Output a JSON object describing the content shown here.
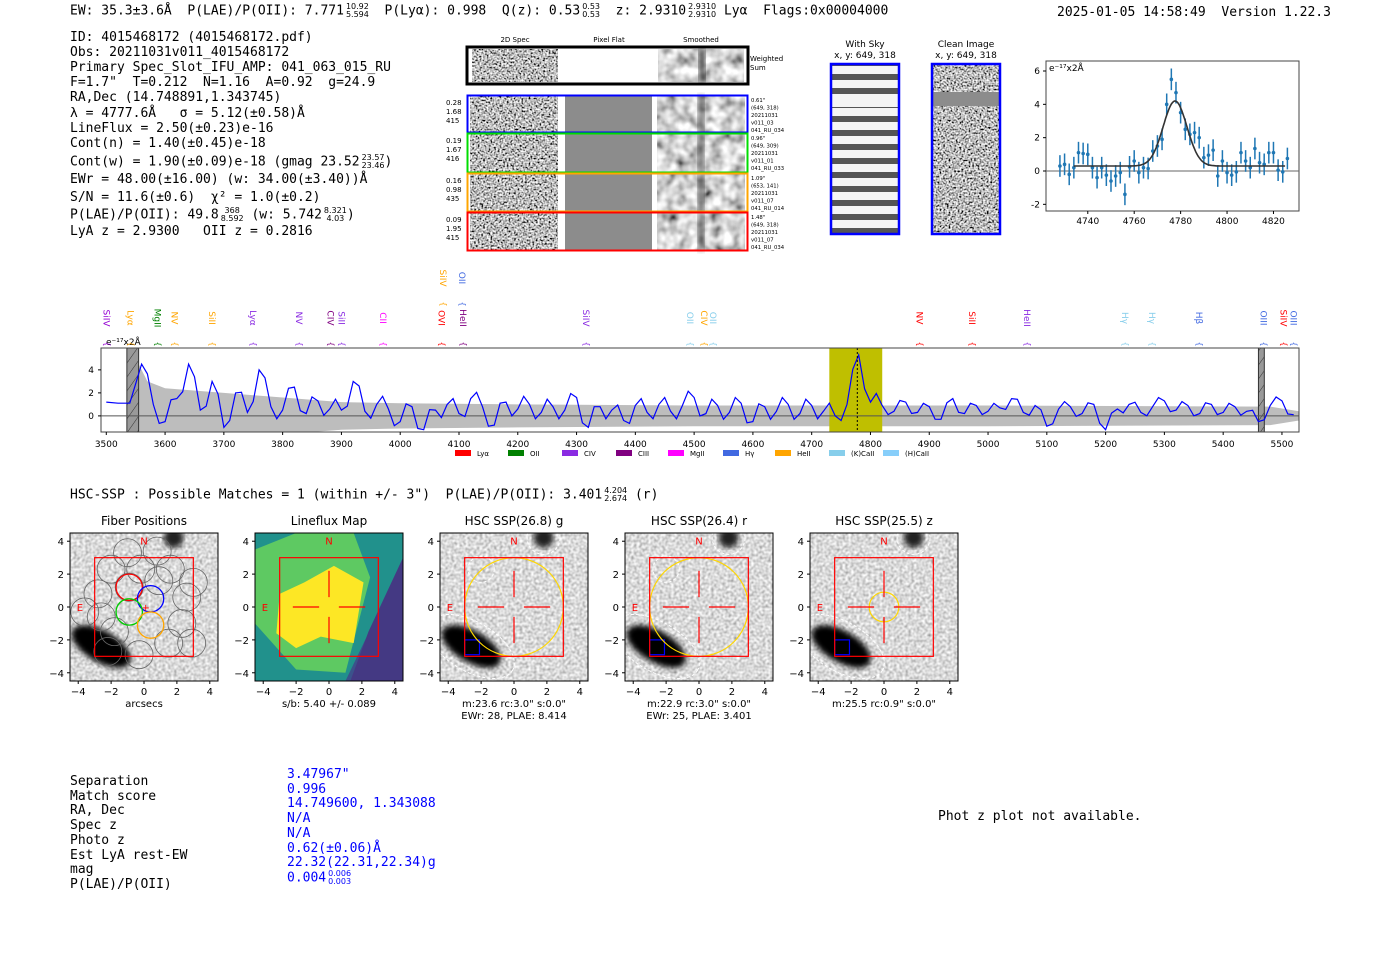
{
  "header": {
    "ew": "EW: 35.3±3.6Å",
    "plae": "P(LAE)/P(OII): 7.771",
    "plae_hi": "10.92",
    "plae_lo": "5.594",
    "plya": "P(Lyα): 0.998",
    "qz": "Q(z): 0.53",
    "qz_hi": "0.53",
    "qz_lo": "0.53",
    "z": "z: 2.9310",
    "z_hi": "2.9310",
    "z_lo": "2.9310",
    "z_line": "Lyα",
    "flags": "Flags:0x00004000",
    "datetime": "2025-01-05 14:58:49",
    "version": "Version 1.22.3"
  },
  "info": {
    "id": "ID: 4015468172 (4015468172.pdf)",
    "obs": "Obs: 20211031v011_4015468172",
    "primary": "Primary Spec_Slot_IFU_AMP: 041_063_015_RU",
    "params": "F=1.7\"  T=0.212  N=1.16  A=0.92  g=24.9",
    "radec": "RA,Dec (14.748891,1.343745)",
    "lambda": "λ = 4777.6Å   σ = 5.12(±0.58)Å",
    "lineflux": "LineFlux = 2.50(±0.23)e-16",
    "cont_n": "Cont(n) = 1.40(±0.45)e-18",
    "cont_w": "Cont(w) = 1.90(±0.09)e-18 (gmag 23.52",
    "cont_w_hi": "23.57",
    "cont_w_lo": "23.46",
    "cont_w_post": ")",
    "ewr": "EWr = 48.00(±16.00) (w: 34.00(±3.40))Å",
    "sn": "S/N = 11.6(±0.6)  χ² = 1.0(±0.2)",
    "plae": "P(LAE)/P(OII): 49.8",
    "plae_hi": "368",
    "plae_lo": "8.592",
    "plae_w": "(w: 5.742",
    "plae_w_hi": "8.321",
    "plae_w_lo": "4.03",
    "plae_post": ")",
    "z": "LyA z = 2.9300   OII z = 0.2816"
  },
  "spec2d": {
    "col_headers": [
      "2D Spec",
      "Pixel Flat",
      "Smoothed"
    ],
    "weighted_label": [
      "Weighted",
      "Sum"
    ],
    "rows": [
      {
        "color": "#0000ff",
        "vals": [
          "0.28",
          "1.68",
          "415"
        ],
        "meta": [
          "0.61\"",
          "(649, 318)",
          "20211031",
          "v011_03",
          "041_RU_034"
        ]
      },
      {
        "color": "#00dd00",
        "vals": [
          "0.19",
          "1.67",
          "416"
        ],
        "meta": [
          "0.96\"",
          "(649, 309)",
          "20211031",
          "v011_01",
          "041_RU_033"
        ]
      },
      {
        "color": "#ffa500",
        "vals": [
          "0.16",
          "0.98",
          "435"
        ],
        "meta": [
          "1.09\"",
          "(653, 141)",
          "20211031",
          "v011_07",
          "041_RU_014"
        ]
      },
      {
        "color": "#ff0000",
        "vals": [
          "0.09",
          "1.95",
          "415"
        ],
        "meta": [
          "1.48\"",
          "(649, 318)",
          "20211031",
          "v011_07",
          "041_RU_034"
        ]
      }
    ]
  },
  "cutouts": [
    {
      "title": "With Sky",
      "coords": "x, y: 649, 318"
    },
    {
      "title": "Clean Image",
      "coords": "x, y: 649, 318"
    }
  ],
  "chart_data": [
    {
      "type": "line",
      "title": "",
      "unit_label": "e⁻¹⁷x2Å",
      "xlim": [
        3491,
        5529
      ],
      "ylim": [
        -1.4,
        5.9
      ],
      "xticks": [
        3500,
        3600,
        3700,
        3800,
        3900,
        4000,
        4100,
        4200,
        4300,
        4400,
        4500,
        4600,
        4700,
        4800,
        4900,
        5000,
        5100,
        5200,
        5300,
        5400,
        5500
      ],
      "yticks": [
        0,
        2,
        4
      ],
      "x_start": 3500,
      "x_step": 20,
      "flux": [
        1.2,
        1.1,
        1.1,
        4.5,
        1.0,
        -0.5,
        1.5,
        4.5,
        0.5,
        3.0,
        -1.0,
        2.0,
        0.3,
        4.0,
        0.8,
        0.5,
        2.5,
        0.2,
        1.3,
        0.6,
        0.5,
        3.0,
        0.4,
        1.0,
        0.6,
        -0.5,
        0.8,
        -1.2,
        0.5,
        1.0,
        0.2,
        1.5,
        0.8,
        -0.8,
        1.2,
        0.6,
        1.0,
        0.3,
        0.8,
        0.5,
        1.6,
        -1.0,
        0.8,
        0.5,
        -0.4,
        0.9,
        0.3,
        1.0,
        0.4,
        0.9,
        1.6,
        0.2,
        0.9,
        0.3,
        1.1,
        -0.5,
        0.8,
        0.4,
        1.0,
        0.2,
        0.9,
        0.4,
        0.0,
        1.0,
        5.3,
        1.2,
        0.9,
        0.4,
        1.2,
        0.3,
        0.8,
        -0.3,
        1.5,
        0.2,
        0.9,
        0.4,
        0.7,
        1.5,
        0.3,
        0.9,
        -0.9,
        0.6,
        0.8,
        0.2,
        1.0,
        -1.2,
        0.6,
        1.0,
        0.3,
        0.8,
        1.3,
        0.5,
        0.9,
        0.2,
        1.0,
        0.3,
        0.8,
        0.4,
        -0.5,
        0.9,
        1.3,
        0.1
      ],
      "error_envelope": [
        [
          3555,
          4.5
        ],
        [
          3570,
          3.0
        ],
        [
          3600,
          2.4
        ],
        [
          3700,
          2.0
        ],
        [
          3800,
          1.6
        ],
        [
          3900,
          1.2
        ],
        [
          4000,
          1.1
        ],
        [
          4200,
          1.0
        ],
        [
          4500,
          0.9
        ],
        [
          5000,
          0.9
        ],
        [
          5480,
          0.8
        ],
        [
          5529,
          0.4
        ]
      ],
      "highlight_band": [
        4730,
        4820
      ],
      "line_center": 4777.6,
      "masked_bands": [
        [
          3535,
          3555
        ],
        [
          5460,
          5470
        ]
      ],
      "line_labels": [
        {
          "label": "SiIV",
          "wave": 3500,
          "color": "#9400d3",
          "row": 0
        },
        {
          "label": "Lyα",
          "wave": 3541,
          "color": "#ffa500",
          "row": 0
        },
        {
          "label": "MgII",
          "wave": 3587,
          "color": "#008000",
          "row": 0
        },
        {
          "label": "NV",
          "wave": 3616,
          "color": "#ffa500",
          "row": 0
        },
        {
          "label": "SiII",
          "wave": 3680,
          "color": "#ffa500",
          "row": 0
        },
        {
          "label": "Lyα",
          "wave": 3750,
          "color": "#8a2be2",
          "row": 0
        },
        {
          "label": "NV",
          "wave": 3828,
          "color": "#8a2be2",
          "row": 0
        },
        {
          "label": "CIV",
          "wave": 3881,
          "color": "#800080",
          "row": 0
        },
        {
          "label": "SiII",
          "wave": 3900,
          "color": "#8a2be2",
          "row": 0
        },
        {
          "label": "CII",
          "wave": 3971,
          "color": "#ff00ff",
          "row": 0
        },
        {
          "label": "OVI",
          "wave": 4070,
          "color": "#ff0000",
          "row": 0
        },
        {
          "label": "HeII",
          "wave": 4107,
          "color": "#800080",
          "row": 0
        },
        {
          "label": "SiIV",
          "wave": 4073,
          "color": "#ffa500",
          "row": 1
        },
        {
          "label": "OII",
          "wave": 4105,
          "color": "#4169e1",
          "row": 1
        },
        {
          "label": "SiIV",
          "wave": 4316,
          "color": "#8a2be2",
          "row": 0
        },
        {
          "label": "OII",
          "wave": 4493,
          "color": "#87ceeb",
          "row": 0
        },
        {
          "label": "CIV",
          "wave": 4517,
          "color": "#ffa500",
          "row": 0
        },
        {
          "label": "OII",
          "wave": 4532,
          "color": "#87ceeb",
          "row": 0
        },
        {
          "label": "NV",
          "wave": 4883,
          "color": "#ff0000",
          "row": 0
        },
        {
          "label": "SiII",
          "wave": 4973,
          "color": "#ff0000",
          "row": 0
        },
        {
          "label": "HeII",
          "wave": 5066,
          "color": "#8a2be2",
          "row": 0
        },
        {
          "label": "Hγ",
          "wave": 5233,
          "color": "#87ceeb",
          "row": 0
        },
        {
          "label": "Hγ",
          "wave": 5279,
          "color": "#87ceeb",
          "row": 0
        },
        {
          "label": "Hβ",
          "wave": 5359,
          "color": "#4169e1",
          "row": 0
        },
        {
          "label": "OIII",
          "wave": 5469,
          "color": "#4169e1",
          "row": 0
        },
        {
          "label": "SiIV",
          "wave": 5503,
          "color": "#ff0000",
          "row": 0
        },
        {
          "label": "OIII",
          "wave": 5520,
          "color": "#4169e1",
          "row": 0
        }
      ],
      "legend": [
        {
          "label": "Lyα",
          "color": "#ff0000"
        },
        {
          "label": "OII",
          "color": "#008000"
        },
        {
          "label": "CIV",
          "color": "#8a2be2"
        },
        {
          "label": "CIII",
          "color": "#800080"
        },
        {
          "label": "MgII",
          "color": "#ff00ff"
        },
        {
          "label": "Hγ",
          "color": "#4169e1"
        },
        {
          "label": "HeII",
          "color": "#ffa500"
        },
        {
          "label": "(K)CaII",
          "color": "#87ceeb"
        },
        {
          "label": "(H)CaII",
          "color": "#87cefa"
        }
      ],
      "legend_position": "bottom-center"
    },
    {
      "type": "scatter",
      "title": "",
      "unit_label": "e⁻¹⁷x2Å",
      "xlim": [
        4722,
        4831
      ],
      "ylim": [
        -2.4,
        6.6
      ],
      "xticks": [
        4740,
        4760,
        4780,
        4800,
        4820
      ],
      "yticks": [
        -2,
        0,
        2,
        4,
        6
      ],
      "x": [
        4728,
        4730,
        4732,
        4734,
        4736,
        4738,
        4740,
        4742,
        4744,
        4746,
        4748,
        4750,
        4752,
        4754,
        4756,
        4758,
        4760,
        4762,
        4764,
        4766,
        4768,
        4770,
        4772,
        4774,
        4776,
        4778,
        4780,
        4782,
        4784,
        4786,
        4788,
        4790,
        4792,
        4794,
        4796,
        4798,
        4800,
        4802,
        4804,
        4806,
        4808,
        4810,
        4812,
        4814,
        4816,
        4818,
        4820,
        4822,
        4824,
        4826
      ],
      "y": [
        0.3,
        0.4,
        -0.2,
        0.2,
        1.1,
        1.05,
        1.0,
        0.2,
        -0.4,
        0.2,
        -0.25,
        -0.6,
        -0.3,
        -0.1,
        -1.4,
        0.25,
        0.6,
        -0.1,
        0.2,
        0.15,
        1.2,
        1.5,
        1.9,
        4.0,
        5.5,
        4.7,
        3.5,
        2.5,
        2.2,
        2.3,
        2.0,
        0.8,
        0.95,
        1.25,
        -0.3,
        0.6,
        -0.1,
        -0.25,
        -0.05,
        1.1,
        0.6,
        0.2,
        1.35,
        0.5,
        0.4,
        1.1,
        1.1,
        0.05,
        -0.05,
        0.75
      ],
      "yerr": 0.65,
      "fit": {
        "model": "gaussian",
        "center": 4777.6,
        "sigma": 5.12,
        "amplitude": 3.9,
        "continuum": 0.3,
        "range": [
          4734,
          4825
        ]
      }
    }
  ],
  "hsc": {
    "summary": "HSC-SSP : Possible Matches = 1 (within +/- 3\")  P(LAE)/P(OII): 3.401",
    "summary_hi": "4.204",
    "summary_lo": "2.674",
    "summary_post": "(r)",
    "north": "N",
    "east": "E",
    "panels": [
      {
        "title": "Fiber Positions",
        "kind": "fiber",
        "captions": [
          "arcsecs"
        ]
      },
      {
        "title": "Lineflux Map",
        "kind": "lineflux",
        "captions": [
          "s/b: 5.40 +/- 0.089"
        ]
      },
      {
        "title": "HSC SSP(26.8) g",
        "kind": "hsc",
        "aperture_arcsec": 3.0,
        "captions": [
          "m:23.6 rc:3.0\"  s:0.0\"",
          "EWr: 28, PLAE: 8.414"
        ]
      },
      {
        "title": "HSC SSP(26.4) r",
        "kind": "hsc",
        "aperture_arcsec": 3.0,
        "captions": [
          "m:22.9 rc:3.0\"  s:0.0\"",
          "EWr: 25, PLAE: 3.401"
        ]
      },
      {
        "title": "HSC SSP(25.5) z",
        "kind": "hsc",
        "aperture_arcsec": 0.9,
        "captions": [
          "m:25.5 rc:0.9\"  s:0.0\""
        ]
      }
    ],
    "ticks": [
      "−4",
      "−2",
      "0",
      "2",
      "4"
    ]
  },
  "match": {
    "labels": [
      "Separation",
      "Match score",
      "RA, Dec",
      "Spec z",
      "Photo z",
      "Est LyA rest-EW",
      "mag",
      "P(LAE)/P(OII)"
    ],
    "values": [
      "3.47967\"",
      "0.996",
      "14.749600, 1.343088",
      "N/A",
      "N/A",
      "0.62(±0.06)Å",
      "22.32(22.31,22.34)g",
      "0.004"
    ],
    "plae_hi": "0.006",
    "plae_lo": "0.003"
  },
  "photz_message": "Phot z plot not available."
}
